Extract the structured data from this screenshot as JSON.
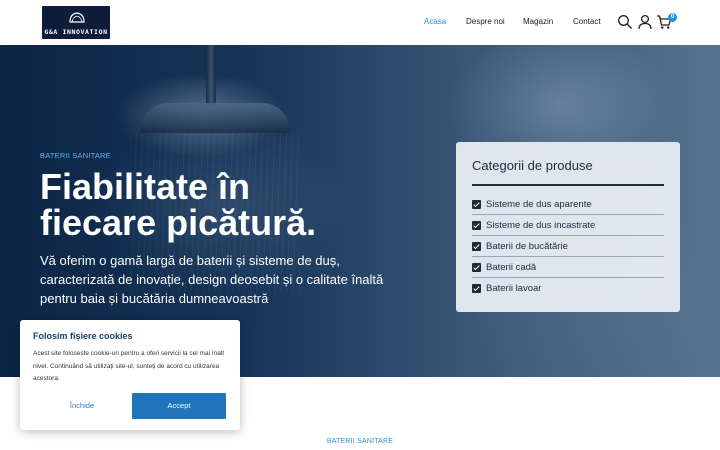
{
  "header": {
    "logo_text": "G&A INNOVATION",
    "nav": [
      "Acasa",
      "Despre noi",
      "Magazin",
      "Contact"
    ],
    "active_nav": "Acasa",
    "cart_count": "0",
    "icons": [
      "search-icon",
      "user-icon",
      "cart-icon"
    ]
  },
  "hero": {
    "tag": "BATERII SANITARE",
    "title_line1": "Fiabilitate în",
    "title_line2": "fiecare picătură.",
    "subtitle": "Vă oferim o gamă largă de baterii și sisteme de duș, caracterizată de inovație, design deosebit și o calitate înaltă pentru baia și bucătăria dumneavoastră"
  },
  "categories": {
    "title": "Categorii de produse",
    "items": [
      "Sisteme de dus aparente",
      "Sisteme de dus incastrate",
      "Baterii de bucătărie",
      "Baterii cadă",
      "Baterii lavoar"
    ]
  },
  "cookie": {
    "title": "Folosim fișiere cookies",
    "text": "Acest site folosește cookie-uri pentru a oferi servicii la cel mai înalt nivel. Continuând să utilizați site-ul, sunteți de acord cu utilizarea acestora.",
    "close_label": "Închide",
    "accept_label": "Accept"
  },
  "section": {
    "tag": "BATERII SANITARE"
  },
  "colors": {
    "accent": "#2a8fd6",
    "button": "#2074b9",
    "logo_bg": "#0f1d3a"
  }
}
